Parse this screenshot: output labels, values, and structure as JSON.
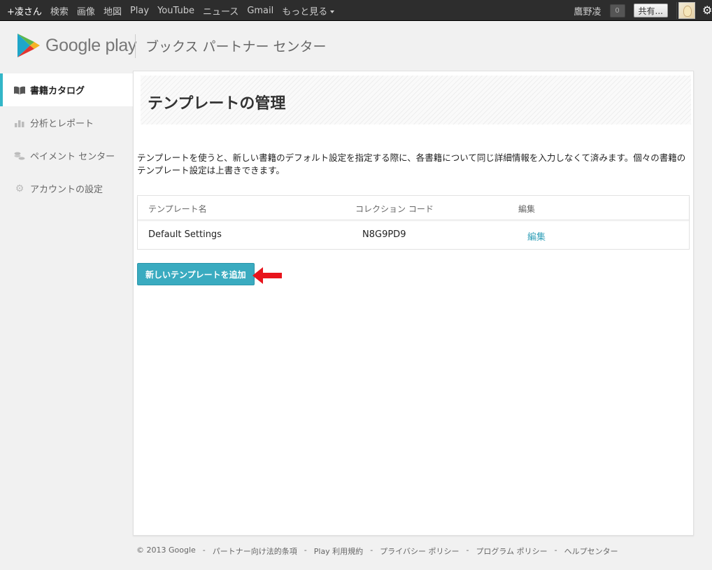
{
  "topbar": {
    "links": [
      "+凌さん",
      "検索",
      "画像",
      "地図",
      "Play",
      "YouTube",
      "ニュース",
      "Gmail"
    ],
    "more_label": "もっと見る",
    "user_name": "鷹野凌",
    "notification_count": "0",
    "share_label": "共有..."
  },
  "header": {
    "logo_text": "Google play",
    "subtitle": "ブックス パートナー センター"
  },
  "sidebar": {
    "items": [
      {
        "label": "書籍カタログ",
        "icon": "book-icon",
        "active": true
      },
      {
        "label": "分析とレポート",
        "icon": "bar-chart-icon",
        "active": false
      },
      {
        "label": "ペイメント センター",
        "icon": "coins-icon",
        "active": false
      },
      {
        "label": "アカウントの設定",
        "icon": "gear-icon",
        "active": false
      }
    ]
  },
  "main": {
    "title": "テンプレートの管理",
    "description": "テンプレートを使うと、新しい書籍のデフォルト設定を指定する際に、各書籍について同じ詳細情報を入力しなくて済みます。個々の書籍のテンプレート設定は上書きできます。",
    "table": {
      "headers": [
        "テンプレート名",
        "コレクション コード",
        "編集"
      ],
      "rows": [
        {
          "name": "Default Settings",
          "code": "N8G9PD9",
          "edit": "編集"
        }
      ]
    },
    "add_button": "新しいテンプレートを追加"
  },
  "footer": {
    "copyright": "© 2013 Google",
    "links": [
      "パートナー向け法的条項",
      "Play 利用規約",
      "プライバシー ポリシー",
      "プログラム ポリシー",
      "ヘルプセンター"
    ]
  },
  "colors": {
    "accent": "#33b6c8",
    "button": "#3aabc0",
    "link": "#33a0b8",
    "arrow": "#e8141c"
  }
}
